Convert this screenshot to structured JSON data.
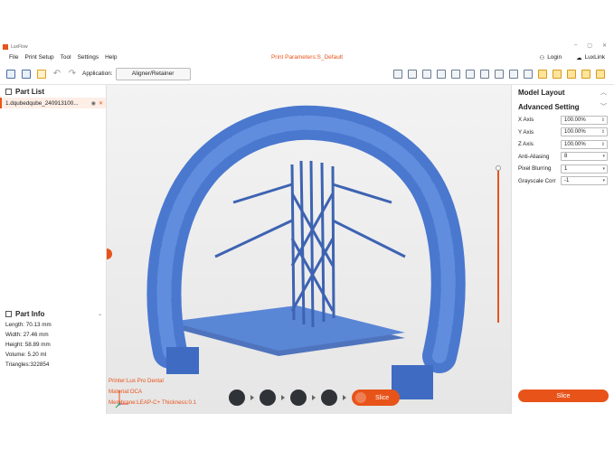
{
  "app": {
    "title": "LuxFlow",
    "print_params": "Print Parameters:S_Default"
  },
  "window": {
    "minimize": "–",
    "maximize": "▢",
    "close": "✕"
  },
  "menu": [
    "File",
    "Print Setup",
    "Tool",
    "Settings",
    "Help"
  ],
  "account": {
    "login": "Login",
    "luxlink": "LuxLink"
  },
  "toolbar": {
    "application_label": "Application:",
    "application_value": "Aligner/Retainer"
  },
  "part_list": {
    "title": "Part List",
    "items": [
      {
        "label": "1.dqubedqube_240913100..."
      }
    ]
  },
  "part_info": {
    "title": "Part Info",
    "rows": [
      "Length:  70.13 mm",
      "Width:   27.46 mm",
      "Height:  58.89 mm",
      "Volume:  5.20 ml",
      "Triangles:322854"
    ]
  },
  "viewport": {
    "printer": "Printer:Lux Pro Dental",
    "material": "Material:OCA",
    "membrane": "Membrane:LEAP-C+ Thickness:0.1",
    "slice_label": "Slice",
    "model_color": "#4a78cf",
    "accent": "#e8531a"
  },
  "model_layout": {
    "title": "Model Layout",
    "advanced_title": "Advanced Setting",
    "rows": [
      {
        "label": "X Axis",
        "value": "100.00%"
      },
      {
        "label": "Y Axis",
        "value": "100.00%"
      },
      {
        "label": "Z Axis",
        "value": "100.00%"
      },
      {
        "label": "Anti-Aliasing",
        "value": "8"
      },
      {
        "label": "Pixel Blurring",
        "value": "1"
      },
      {
        "label": "Grayscale Corr",
        "value": "-1"
      }
    ],
    "slice_button": "Slice"
  }
}
